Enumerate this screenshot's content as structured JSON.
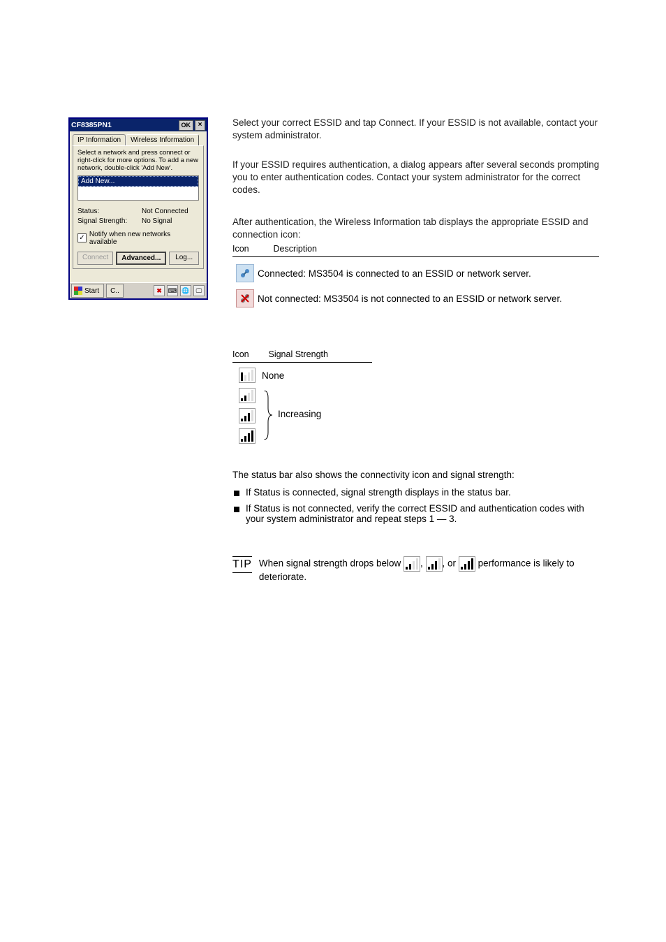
{
  "dialog": {
    "title": "CF8385PN1",
    "ok": "OK",
    "close": "×",
    "tabs": {
      "ip": "IP Information",
      "wi": "Wireless Information"
    },
    "instr": "Select a network and press connect or right-click for more options.  To add a new network, double-click 'Add New'.",
    "listitem": "Add New...",
    "status_k": "Status:",
    "status_v": "Not Connected",
    "sig_k": "Signal Strength:",
    "sig_v": "No Signal",
    "notify": "Notify when new networks available",
    "btn_connect": "Connect",
    "btn_adv": "Advanced...",
    "btn_log": "Log..."
  },
  "taskbar": {
    "start": "Start",
    "item": "C.."
  },
  "steps": {
    "s1": "Select your correct ESSID and tap Connect. If your ESSID is not available, contact your system administrator.",
    "s2": "If your ESSID requires authentication, a dialog appears after several seconds prompting you to enter authentication codes. Contact your system administrator for the correct codes.",
    "s3": "After authentication, the Wireless Information tab displays the appropriate ESSID and connection icon:"
  },
  "tbl1": {
    "head_icon": "Icon",
    "head_desc": "Description",
    "row1_desc": "Connected: MS3504 is connected to an ESSID or network server.",
    "row2_desc": "Not connected: MS3504 is not connected to an ESSID or network server."
  },
  "tbl2": {
    "head_icon": "Icon",
    "head_desc": "Signal Strength",
    "none": "None",
    "inc": "Increasing"
  },
  "bullet_intro": "The status bar also shows the connectivity icon and signal strength:",
  "bullets": [
    "If Status is connected, signal strength displays in the status bar.",
    "If Status is not connected, verify the correct ESSID and authentication codes with your system administrator and repeat steps 1 — 3."
  ],
  "tip": {
    "label": "TIP",
    "text_a": "When signal strength drops below ",
    "text_b": " performance is likely to deteriorate."
  }
}
